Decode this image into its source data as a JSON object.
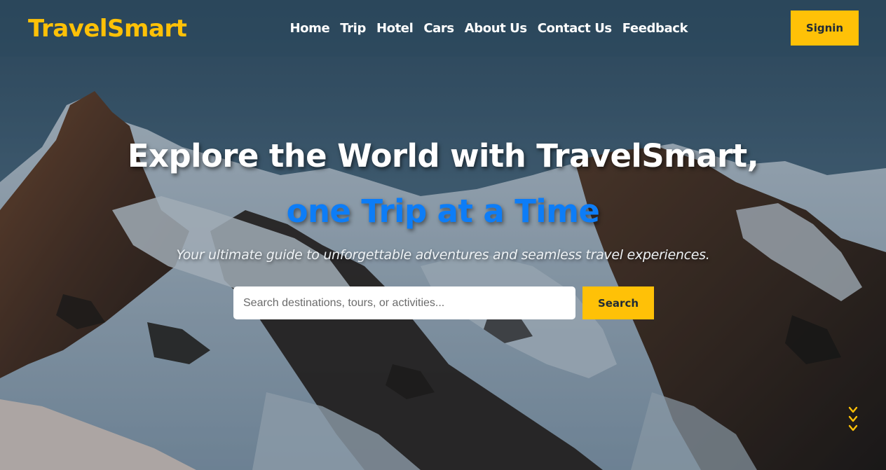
{
  "brand": {
    "name": "TravelSmart",
    "color": "#ffc107"
  },
  "nav": {
    "links": [
      "Home",
      "Trip",
      "Hotel",
      "Cars",
      "About Us",
      "Contact Us",
      "Feedback"
    ],
    "signin_label": "Signin"
  },
  "hero": {
    "title": "Explore the World with TravelSmart,",
    "highlight": "one Trip at a Time",
    "highlight_color": "#0d7df7",
    "subtitle": "Your ultimate guide to unforgettable adventures and seamless travel experiences."
  },
  "search": {
    "placeholder": "Search destinations, tours, or activities...",
    "value": "",
    "button_label": "Search"
  },
  "scroll_indicator": {
    "icon": "chevrons-down-icon",
    "color": "#ffc107"
  },
  "background": {
    "image": "snowy-mountains-image"
  }
}
